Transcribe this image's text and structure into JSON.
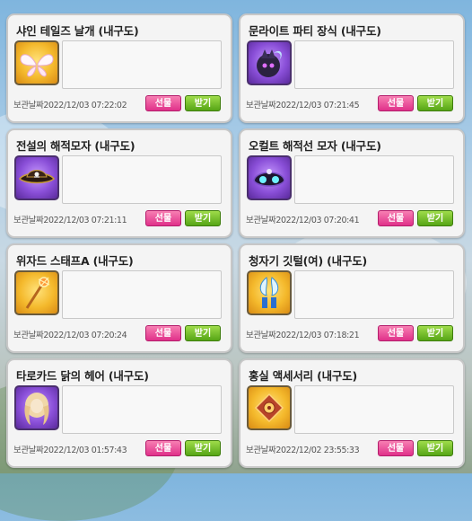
{
  "date_label": "보관날짜",
  "buttons": {
    "gift": "선물",
    "receive": "받기"
  },
  "items": [
    {
      "name": "샤인 테일즈 날개 (내구도)",
      "date": "2022/12/03 07:22:02",
      "icon": "wings-icon",
      "frame": "gold"
    },
    {
      "name": "문라이트 파티 장식 (내구도)",
      "date": "2022/12/03 07:21:45",
      "icon": "moonlight-party-ornament-icon",
      "frame": "purple"
    },
    {
      "name": "전설의 해적모자 (내구도)",
      "date": "2022/12/03 07:21:11",
      "icon": "pirate-hat-icon",
      "frame": "purple"
    },
    {
      "name": "오컬트 해적선 모자 (내구도)",
      "date": "2022/12/03 07:20:41",
      "icon": "occult-pirate-hat-icon",
      "frame": "purple"
    },
    {
      "name": "위자드 스태프A (내구도)",
      "date": "2022/12/03 07:20:24",
      "icon": "wizard-staff-icon",
      "frame": "gold"
    },
    {
      "name": "청자기 깃털(여) (내구도)",
      "date": "2022/12/03 07:18:21",
      "icon": "feather-ornament-icon",
      "frame": "gold"
    },
    {
      "name": "타로카드 닭의 헤어 (내구도)",
      "date": "2022/12/03 01:57:43",
      "icon": "curly-hair-icon",
      "frame": "purple"
    },
    {
      "name": "홍실 액세서리 (내구도)",
      "date": "2022/12/02 23:55:33",
      "icon": "red-thread-accessory-icon",
      "frame": "gold"
    }
  ]
}
